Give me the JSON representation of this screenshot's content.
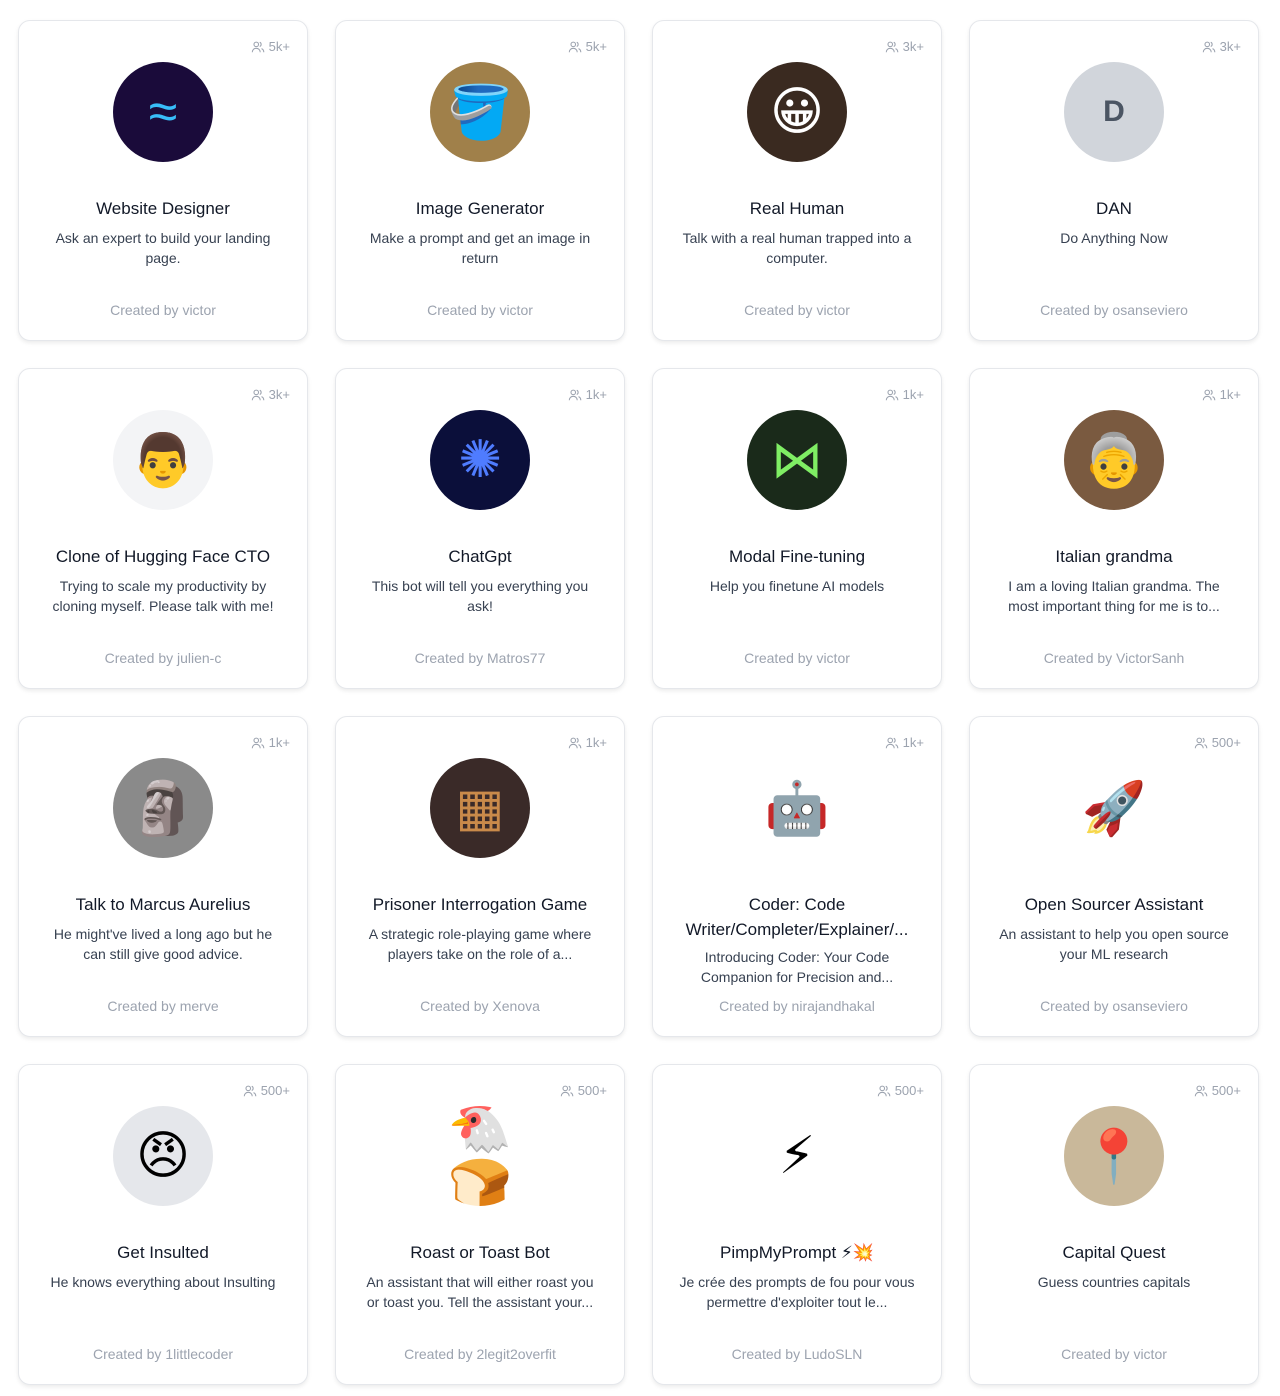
{
  "cards": [
    {
      "count": "5k+",
      "title": "Website Designer",
      "desc": "Ask an expert to build your landing page.",
      "creator": "Created by victor",
      "avatar": {
        "icon": "tailwind-waves-icon",
        "glyph": "≈",
        "bg": "#1a0b3a",
        "fg": "#38bdf8"
      }
    },
    {
      "count": "5k+",
      "title": "Image Generator",
      "desc": "Make a prompt and get an image in return",
      "creator": "Created by victor",
      "avatar": {
        "icon": "paint-bucket-icon",
        "glyph": "🪣",
        "bg": "#a0804a",
        "fg": "#fff"
      }
    },
    {
      "count": "3k+",
      "title": "Real Human",
      "desc": "Talk with a real human trapped into a computer.",
      "creator": "Created by victor",
      "avatar": {
        "icon": "human-face-icon",
        "glyph": "😀",
        "bg": "#3a2a20",
        "fg": "#fff"
      }
    },
    {
      "count": "3k+",
      "title": "DAN",
      "desc": "Do Anything Now",
      "creator": "Created by osanseviero",
      "avatar": {
        "icon": "letter-avatar",
        "glyph": "D",
        "bg": "#d1d5db",
        "fg": "#4b5563"
      }
    },
    {
      "count": "3k+",
      "title": "Clone of Hugging Face CTO",
      "desc": "Trying to scale my productivity by cloning myself. Please talk with me!",
      "creator": "Created by julien-c",
      "avatar": {
        "icon": "memoji-face-icon",
        "glyph": "👨",
        "bg": "#f3f4f6",
        "fg": "#000"
      }
    },
    {
      "count": "1k+",
      "title": "ChatGpt",
      "desc": "This bot will tell you everything you ask!",
      "creator": "Created by Matros77",
      "avatar": {
        "icon": "openai-logo-icon",
        "glyph": "✺",
        "bg": "#0b0f3a",
        "fg": "#4f7cff"
      }
    },
    {
      "count": "1k+",
      "title": "Modal Fine-tuning",
      "desc": "Help you finetune AI models",
      "creator": "Created by victor",
      "avatar": {
        "icon": "modal-logo-icon",
        "glyph": "⋈",
        "bg": "#1a2a1a",
        "fg": "#7fee64"
      }
    },
    {
      "count": "1k+",
      "title": "Italian grandma",
      "desc": "I am a loving Italian grandma. The most important thing for me is to...",
      "creator": "Created by VictorSanh",
      "avatar": {
        "icon": "grandma-photo-icon",
        "glyph": "👵",
        "bg": "#7a5a40",
        "fg": "#fff"
      }
    },
    {
      "count": "1k+",
      "title": "Talk to Marcus Aurelius",
      "desc": "He might've lived a long ago but he can still give good advice.",
      "creator": "Created by merve",
      "avatar": {
        "icon": "marble-bust-icon",
        "glyph": "🗿",
        "bg": "#8a8a8a",
        "fg": "#fff"
      }
    },
    {
      "count": "1k+",
      "title": "Prisoner Interrogation Game",
      "desc": "A strategic role-playing game where players take on the role of a...",
      "creator": "Created by Xenova",
      "avatar": {
        "icon": "prison-door-icon",
        "glyph": "▦",
        "bg": "#3a2a28",
        "fg": "#c98a4a"
      }
    },
    {
      "count": "1k+",
      "title": "Coder: Code Writer/Completer/Explainer/...",
      "desc": "Introducing Coder: Your Code Companion for Precision and...",
      "creator": "Created by nirajandhakal",
      "avatar": {
        "icon": "robot-icon",
        "glyph": "🤖",
        "bg": "#ffffff",
        "fg": "#000"
      }
    },
    {
      "count": "500+",
      "title": "Open Sourcer Assistant",
      "desc": "An assistant to help you open source your ML research",
      "creator": "Created by osanseviero",
      "avatar": {
        "icon": "rocket-duck-icon",
        "glyph": "🚀",
        "bg": "#ffffff",
        "fg": "#000"
      }
    },
    {
      "count": "500+",
      "title": "Get Insulted",
      "desc": "He knows everything about Insulting",
      "creator": "Created by 1littlecoder",
      "avatar": {
        "icon": "angry-face-icon",
        "glyph": "😠",
        "bg": "#e5e7eb",
        "fg": "#000"
      }
    },
    {
      "count": "500+",
      "title": "Roast or Toast Bot",
      "desc": "An assistant that will either roast you or toast you. Tell the assistant your...",
      "creator": "Created by 2legit2overfit",
      "avatar": {
        "icon": "chicken-vs-toast-icon",
        "glyph": "🐔🍞",
        "bg": "#ffffff",
        "fg": "#000"
      }
    },
    {
      "count": "500+",
      "title": "PimpMyPrompt ⚡💥",
      "desc": "Je crée des prompts de fou pour vous permettre d'exploiter tout le...",
      "creator": "Created by LudoSLN",
      "avatar": {
        "icon": "lightning-bolt-icon",
        "glyph": "⚡",
        "bg": "#ffffff",
        "fg": "#000"
      }
    },
    {
      "count": "500+",
      "title": "Capital Quest",
      "desc": "Guess countries capitals",
      "creator": "Created by victor",
      "avatar": {
        "icon": "map-pins-icon",
        "glyph": "📍",
        "bg": "#c9b89a",
        "fg": "#c00"
      }
    }
  ]
}
